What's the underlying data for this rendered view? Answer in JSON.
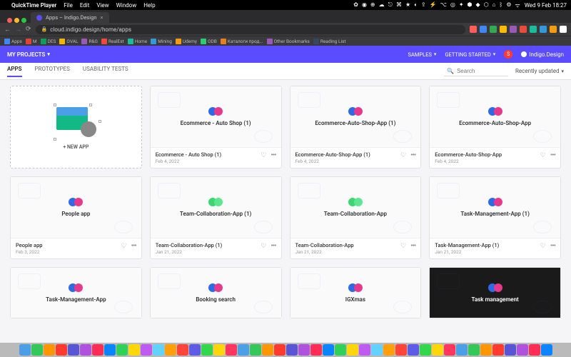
{
  "macos": {
    "app": "QuickTime Player",
    "menu": [
      "File",
      "Edit",
      "View",
      "Window",
      "Help"
    ],
    "datetime": "Wed 9 Feb 18:27"
  },
  "browser": {
    "tab_title": "Apps – Indigo.Design",
    "url": "cloud.indigo.design/home/apps",
    "bookmarks": [
      "Apps",
      "M",
      "DES",
      "OVAL",
      "R&G",
      "RealEst",
      "Home",
      "Mining",
      "Udemy",
      "ODB",
      "Каталоги прод...",
      "Other Bookmarks",
      "Reading List"
    ]
  },
  "header": {
    "my_projects": "MY PROJECTS",
    "samples": "SAMPLES",
    "getting_started": "GETTING STARTED",
    "avatar_initial": "S",
    "brand": "Indigo.Design"
  },
  "toolbar": {
    "tabs": {
      "apps": "APPS",
      "prototypes": "PROTOTYPES",
      "usability": "USABILITY TESTS"
    },
    "search_placeholder": "Search",
    "sort": "Recently updated"
  },
  "new_app": {
    "label": "+ NEW APP"
  },
  "cards": [
    {
      "name": "Ecommerce - Auto Shop (1)",
      "footer_title": "Ecommerce - Auto Shop (1)",
      "date": "Feb 4, 2022",
      "dots": "bp"
    },
    {
      "name": "Ecommerce-Auto-Shop-App (1)",
      "footer_title": "Ecommerce-Auto-Shop-App (1)",
      "date": "Feb 4, 2022",
      "dots": "bp"
    },
    {
      "name": "Ecommerce-Auto-Shop-App",
      "footer_title": "Ecommerce-Auto-Shop-App",
      "date": "Feb 4, 2022",
      "dots": "bp"
    },
    {
      "name": "People app",
      "footer_title": "People app",
      "date": "Feb 3, 2022",
      "dots": "bp"
    },
    {
      "name": "Team-Collaboration-App (1)",
      "footer_title": "Team-Collaboration-App (1)",
      "date": "Jan 21, 2022",
      "dots": "gg"
    },
    {
      "name": "Team-Collaboration-App",
      "footer_title": "Team-Collaboration-App",
      "date": "Jan 21, 2022",
      "dots": "gg"
    },
    {
      "name": "Task-Management-App (1)",
      "footer_title": "Task-Management-App (1)",
      "date": "Jan 21, 2022",
      "dots": "bp"
    },
    {
      "name": "Task-Management-App",
      "footer_title": "",
      "date": "",
      "dots": "bp"
    },
    {
      "name": "Booking search",
      "footer_title": "",
      "date": "",
      "dots": "bp"
    },
    {
      "name": "IGXmas",
      "footer_title": "",
      "date": "",
      "dots": "bp"
    },
    {
      "name": "Task management",
      "footer_title": "",
      "date": "",
      "dots": "bp",
      "dark": true
    }
  ],
  "ext_colors": [
    "#ff5f57",
    "#4285f4",
    "#34a853",
    "#fbbc05",
    "#9b59b6",
    "#e74c3c",
    "#1abc9c",
    "#3498db",
    "#f39c12",
    "#fff"
  ],
  "dock_colors": [
    "#4a9fe6",
    "#34c759",
    "#ff9500",
    "#ff3b30",
    "#5856d6",
    "#af52de",
    "#ff2d55",
    "#0a84ff",
    "#30d158",
    "#ffd60a",
    "#bf5af2",
    "#64d2ff",
    "#ff9f0a",
    "#ff453a",
    "#5e5ce6",
    "#32d74b",
    "#ffd60a",
    "#ff375f",
    "#4a9fe6",
    "#34c759",
    "#ff9500",
    "#ff3b30",
    "#5856d6",
    "#af52de",
    "#ff2d55",
    "#0a84ff",
    "#30d158",
    "#ffd60a",
    "#bf5af2",
    "#64d2ff",
    "#ff9f0a",
    "#ff453a",
    "#5e5ce6",
    "#32d74b",
    "#ffd60a",
    "#ff375f",
    "#4a9fe6",
    "#34c759",
    "#ff9500",
    "#ff3b30",
    "#5856d6",
    "#af52de",
    "#ff2d55",
    "#0a84ff"
  ]
}
